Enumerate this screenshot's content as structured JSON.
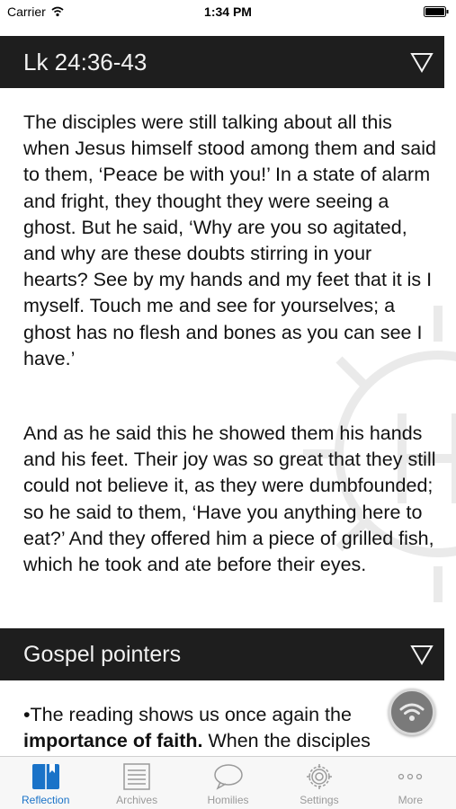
{
  "status_bar": {
    "carrier": "Carrier",
    "time": "1:34 PM"
  },
  "reading": {
    "reference": "Lk 24:36-43",
    "paragraphs": [
      "The disciples were still talking about all this when Jesus himself stood among them and said to them, ‘Peace be with you!’ In a state of alarm and fright, they thought they were seeing a ghost. But he said, ‘Why are you so agitated, and why are these doubts stirring in your hearts? See by my hands and my feet that it is I myself. Touch me and see for yourselves; a ghost has no flesh and bones as you can see I have.’",
      "And as he said this he showed them his hands and his feet. Their joy was so great that they still could not believe it, as they were dumbfounded; so he said to them, ‘Have you anything here to eat?’ And they offered him a piece of grilled fish, which he took and ate before their eyes."
    ]
  },
  "pointers": {
    "title": "Gospel pointers",
    "first_line_prefix": "•The reading shows us once again the ",
    "emphasis": "importance of faith.",
    "continuation": " When the disciples"
  },
  "tabs": [
    {
      "label": "Reflection",
      "icon": "book-icon",
      "active": true
    },
    {
      "label": "Archives",
      "icon": "list-icon",
      "active": false
    },
    {
      "label": "Homilies",
      "icon": "chat-bubble-icon",
      "active": false
    },
    {
      "label": "Settings",
      "icon": "gear-icon",
      "active": false
    },
    {
      "label": "More",
      "icon": "more-dots-icon",
      "active": false
    }
  ],
  "colors": {
    "header_bg": "#1e1e1e",
    "accent": "#1a73c8",
    "inactive": "#9a9a9a"
  }
}
